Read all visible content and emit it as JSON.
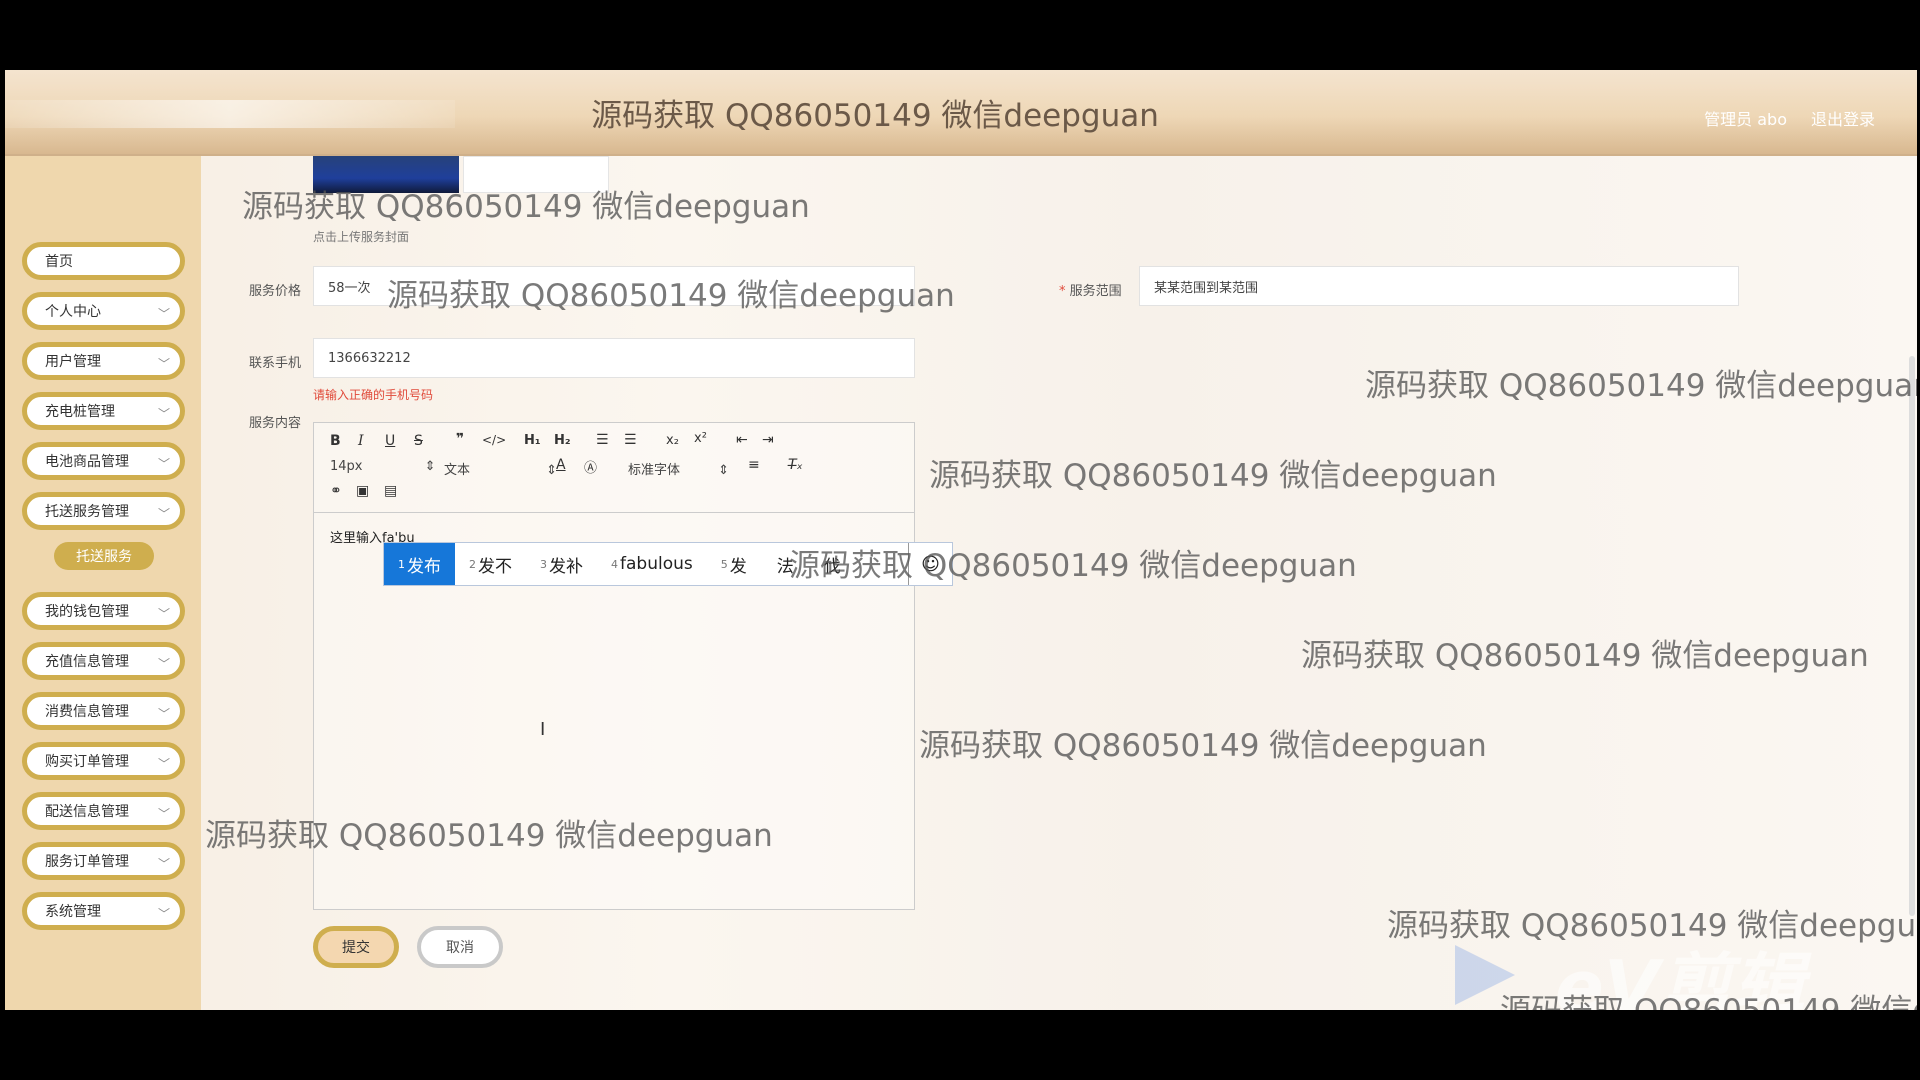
{
  "header": {
    "title": "源码获取 QQ86050149 微信deepguan",
    "admin_label": "管理员 abo",
    "logout_label": "退出登录"
  },
  "sidebar": {
    "items": [
      {
        "label": "首页",
        "expandable": false
      },
      {
        "label": "个人中心",
        "expandable": true
      },
      {
        "label": "用户管理",
        "expandable": true
      },
      {
        "label": "充电桩管理",
        "expandable": true
      },
      {
        "label": "电池商品管理",
        "expandable": true
      },
      {
        "label": "托送服务管理",
        "expandable": true
      },
      {
        "label": "我的钱包管理",
        "expandable": true
      },
      {
        "label": "充值信息管理",
        "expandable": true
      },
      {
        "label": "消费信息管理",
        "expandable": true
      },
      {
        "label": "购买订单管理",
        "expandable": true
      },
      {
        "label": "配送信息管理",
        "expandable": true
      },
      {
        "label": "服务订单管理",
        "expandable": true
      },
      {
        "label": "系统管理",
        "expandable": true
      }
    ],
    "sub_item": "托送服务"
  },
  "form": {
    "cover_hint": "点击上传服务封面",
    "price_label": "服务价格",
    "price_value": "58一次",
    "range_label": "服务范围",
    "range_required": "*",
    "range_value": "某某范围到某范围",
    "phone_label": "联系手机",
    "phone_value": "1366632212",
    "phone_error": "请输入正确的手机号码",
    "content_label": "服务内容"
  },
  "editor": {
    "font_size": "14px",
    "text_type": "文本",
    "font_family": "标准字体",
    "content": "这里输入fa'bu"
  },
  "ime": {
    "candidates": [
      {
        "num": "1",
        "text": "发布"
      },
      {
        "num": "2",
        "text": "发不"
      },
      {
        "num": "3",
        "text": "发补"
      },
      {
        "num": "4",
        "text": "fabulous"
      },
      {
        "num": "5",
        "text": "发"
      },
      {
        "num": "",
        "text": "法"
      },
      {
        "num": "",
        "text": "伐"
      }
    ]
  },
  "buttons": {
    "submit": "提交",
    "cancel": "取消"
  },
  "watermark": "源码获取 QQ86050149 微信deepguan",
  "watermark_cut": "源码获取 QQ86050149 微信d",
  "ev_logo": "eV剪辑"
}
